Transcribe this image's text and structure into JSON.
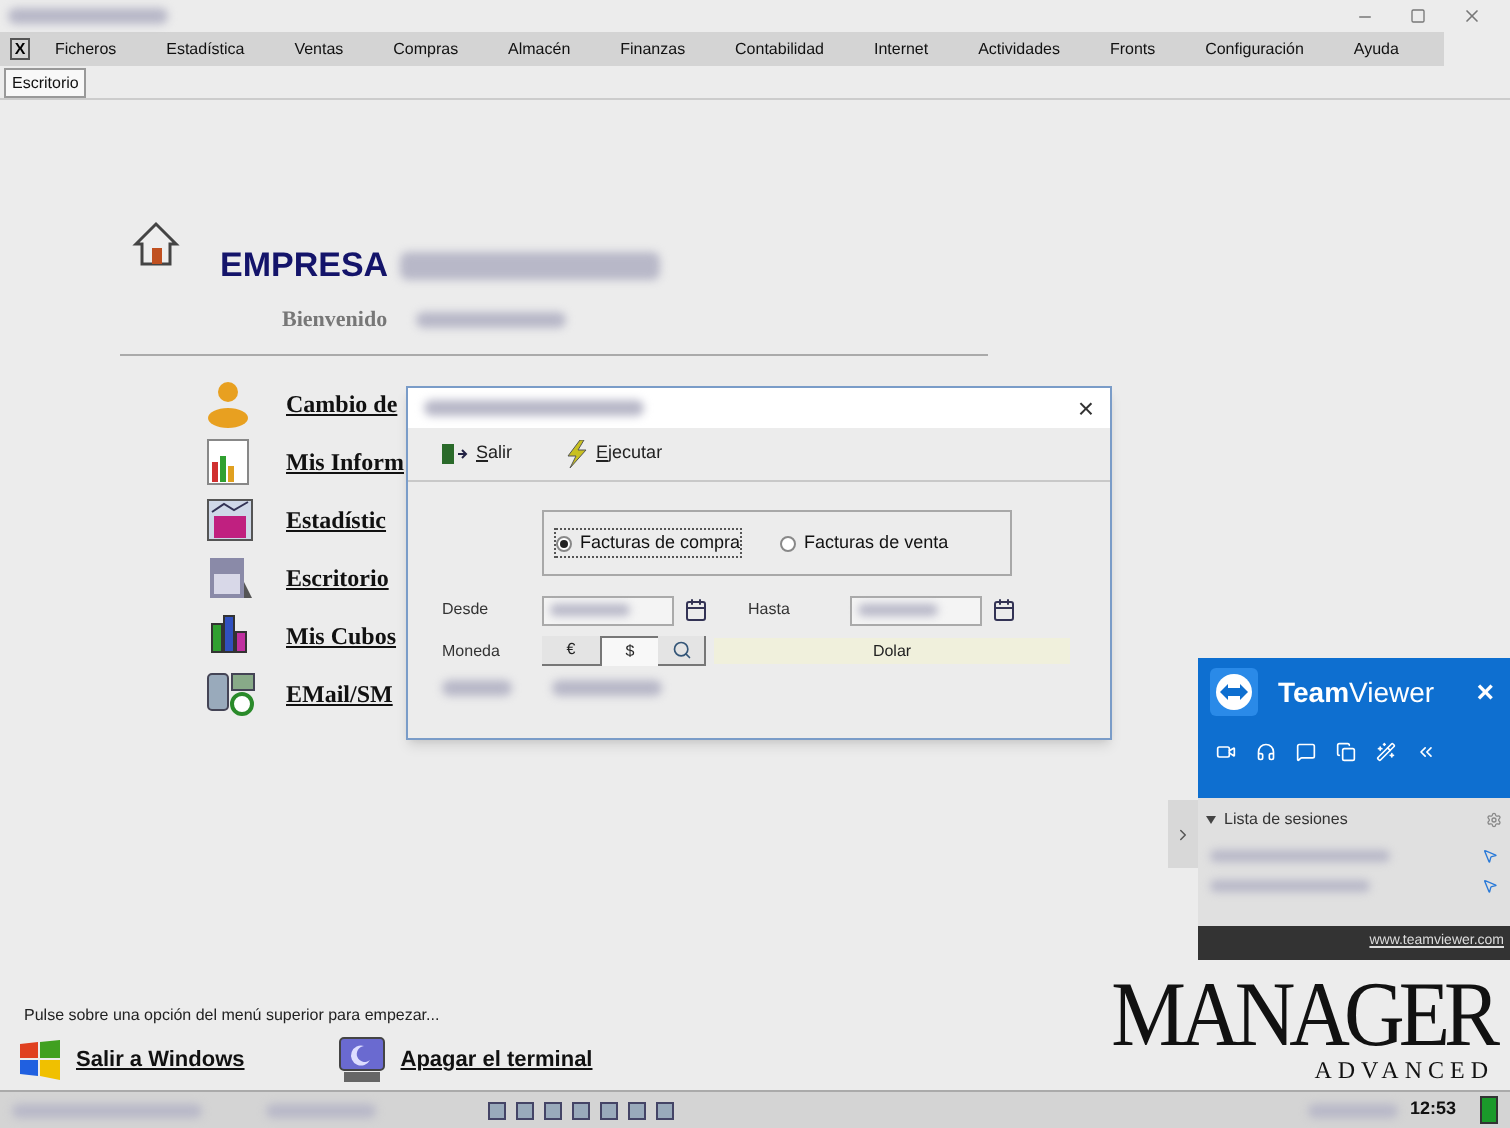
{
  "menu": [
    {
      "label": "Ficheros"
    },
    {
      "label": "Estadística"
    },
    {
      "label": "Ventas"
    },
    {
      "label": "Compras"
    },
    {
      "label": "Almacén"
    },
    {
      "label": "Finanzas"
    },
    {
      "label": "Contabilidad"
    },
    {
      "label": "Internet"
    },
    {
      "label": "Actividades"
    },
    {
      "label": "Fronts"
    },
    {
      "label": "Configuración"
    },
    {
      "label": "Ayuda"
    }
  ],
  "menu_close": "X",
  "tabs": [
    {
      "label": "Escritorio",
      "selected": true
    }
  ],
  "company": {
    "name": "EMPRESA",
    "welcome": "Bienvenido"
  },
  "shortcuts": [
    {
      "label": "Cambio de",
      "kind": "user"
    },
    {
      "label": "Mis Inform",
      "kind": "report"
    },
    {
      "label": "Estadístic",
      "kind": "stats"
    },
    {
      "label": "Escritorio",
      "kind": "desk"
    },
    {
      "label": "Mis Cubos",
      "kind": "cubes"
    },
    {
      "label": "EMail/SM",
      "kind": "mail"
    }
  ],
  "hint": "Pulse sobre una opción del menú superior para empezar...",
  "bottom_actions": [
    {
      "label": "Salir a Windows",
      "kind": "windows"
    },
    {
      "label": "Apagar el terminal",
      "kind": "power"
    }
  ],
  "dialog": {
    "close": "×",
    "toolbar": [
      {
        "label": "Salir",
        "kind": "exit"
      },
      {
        "label": "Ejecutar",
        "kind": "run"
      }
    ],
    "invoice_types": [
      {
        "label": "Facturas de compra",
        "selected": true
      },
      {
        "label": "Facturas de venta",
        "selected": false
      }
    ],
    "from_label": "Desde",
    "to_label": "Hasta",
    "currency_label": "Moneda",
    "currencies": [
      {
        "label": "€",
        "selected": false
      },
      {
        "label": "$",
        "selected": true
      }
    ],
    "currency_name": "Dolar"
  },
  "teamviewer": {
    "brand": "**Team**Viewer",
    "close": "×",
    "sessions_title": "Lista de sesiones",
    "link": "www.teamviewer.com"
  },
  "logo": {
    "title": "MANAGER",
    "subtitle": "ADVANCED"
  },
  "status_bar": {
    "time": "12:53"
  }
}
